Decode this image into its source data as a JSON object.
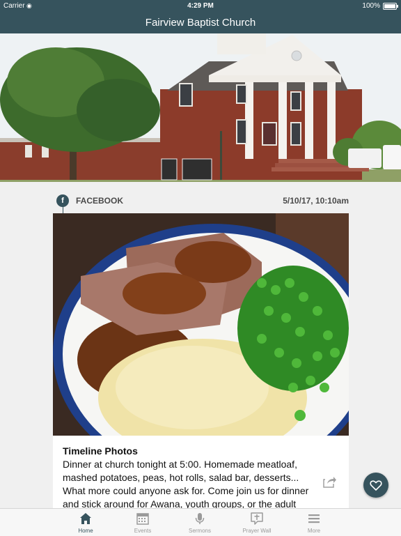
{
  "status_bar": {
    "carrier": "Carrier",
    "time": "4:29 PM",
    "battery": "100%"
  },
  "nav": {
    "title": "Fairview Baptist Church"
  },
  "post": {
    "source": "FACEBOOK",
    "date": "5/10/17, 10:10am",
    "title": "Timeline Photos",
    "body": "Dinner at church tonight at 5:00.  Homemade meatloaf, mashed potatoes, peas, hot rolls, salad bar, desserts... What more could anyone ask for.  Come join us for dinner and stick around for Awana, youth groups, or the adult Bible study and prayer time in the sanctuary."
  },
  "tabs": [
    {
      "label": "Home",
      "icon": "home-icon",
      "active": true
    },
    {
      "label": "Events",
      "icon": "calendar-icon",
      "active": false
    },
    {
      "label": "Sermons",
      "icon": "microphone-icon",
      "active": false
    },
    {
      "label": "Prayer Wall",
      "icon": "prayer-wall-icon",
      "active": false
    },
    {
      "label": "More",
      "icon": "menu-icon",
      "active": false
    }
  ],
  "colors": {
    "brand": "#36535d",
    "tab_inactive": "#9a9a9a"
  }
}
